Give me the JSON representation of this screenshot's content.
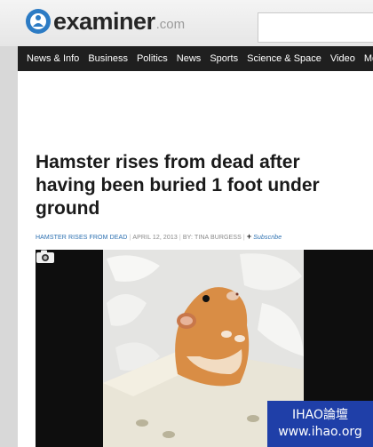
{
  "header": {
    "logo_word": "examiner",
    "logo_tld": ".com",
    "search_placeholder": ""
  },
  "nav": {
    "items": [
      "News & Info",
      "Business",
      "Politics",
      "News",
      "Sports",
      "Science & Space",
      "Video",
      "More"
    ]
  },
  "article": {
    "headline": "Hamster rises from dead after having been buried 1 foot under ground",
    "category": "HAMSTER RISES FROM DEAD",
    "date": "APRIL 12, 2013",
    "author": "BY: TINA BURGESS",
    "subscribe": "Subscribe"
  },
  "watermark": {
    "line1": "IHAO論壇",
    "line2": "www.ihao.org"
  },
  "colors": {
    "nav_bg": "#1f1f1f",
    "link_blue": "#2b6fb0",
    "watermark_bg": "#1f3fa8"
  }
}
